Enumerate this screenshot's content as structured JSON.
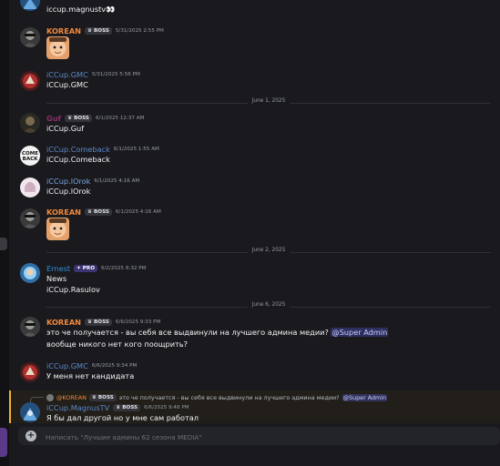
{
  "colors": {
    "korean": "#f0883c",
    "gmc": "#5b88c9",
    "guf": "#8f2c6b",
    "comeback": "#5b88c9",
    "lorok": "#79a5e0",
    "ernest": "#2f8fd6",
    "magnus": "#5b88c9",
    "mention_bg": "#5865f2"
  },
  "top_line": {
    "text": "iccup.magnustv",
    "emoji": "👀"
  },
  "icons": {
    "boss_badge": "crown-icon",
    "pro_badge": "sparkle-icon",
    "add": "plus-circle-icon"
  },
  "messages": [
    {
      "username": "KOREAN",
      "badge": "BOSS",
      "time": "5/31/2025 2:55 PM"
    },
    {
      "username": "iCCup.GMC",
      "time": "5/31/2025 5:56 PM",
      "text": "iCCup.GMC"
    },
    {
      "username": "Guf",
      "badge": "BOSS",
      "time": "6/1/2025 12:37 AM",
      "text": "iCCup.Guf"
    },
    {
      "username": "iCCup.Comeback",
      "time": "6/1/2025 1:55 AM",
      "text": "iCCup.Comeback",
      "avatar_text": "COME BACK"
    },
    {
      "username": "iCCup.lOrok",
      "time": "6/1/2025 4:16 AM",
      "text": "iCCup.lOrok"
    },
    {
      "username": "KOREAN",
      "badge": "BOSS",
      "time": "6/1/2025 4:16 AM"
    },
    {
      "username": "Ernest",
      "badge": "PRO",
      "time": "6/2/2025 8:32 PM",
      "lines": [
        "News",
        "iCCup.Rasulov"
      ]
    },
    {
      "username": "KOREAN",
      "badge": "BOSS",
      "time": "6/6/2025 9:33 PM",
      "line1": "это че получается - вы себя все выдвинули на лучшего админа медии?",
      "mention": "@Super Admin",
      "line2": "вообще никого нет кого поощрить?"
    },
    {
      "username": "iCCup.GMC",
      "time": "6/6/2025 9:34 PM",
      "text": "У меня нет кандидата"
    },
    {
      "username": "iCCup.MagnusTV",
      "badge": "BOSS",
      "time": "6/6/2025 9:48 PM",
      "text": "Я бы дал другой но у мне сам работал"
    }
  ],
  "reply": {
    "author": "@KOREAN",
    "badge": "BOSS",
    "text": "это че получается - вы себя все выдвинули на лучшего админа медии?",
    "mention": "@Super Admin"
  },
  "dividers": [
    "June 1, 2025",
    "June 2, 2025",
    "June 6, 2025"
  ],
  "composer": {
    "placeholder": "Написать \"Лучшие админы 62 сезона MEDIA\""
  }
}
